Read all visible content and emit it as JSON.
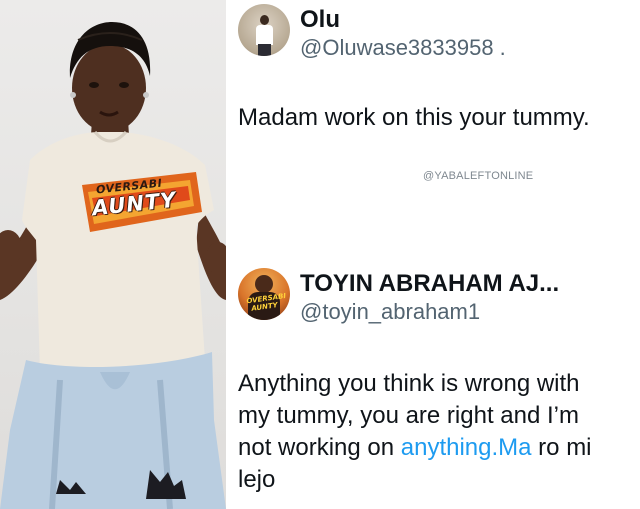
{
  "photo": {
    "shirt_brand_top": "OVERSABI",
    "shirt_brand_main": "AUNTY"
  },
  "tweet1": {
    "display_name": "Olu",
    "handle": "@Oluwase3833958 .",
    "text": "Madam work on this your tummy."
  },
  "watermark": "@YABALEFTONLINE",
  "tweet2": {
    "display_name": "TOYIN ABRAHAM AJ...",
    "handle": "@toyin_abraham1",
    "avatar_text": "OVERSABI AUNTY",
    "text_line1": "Anything you think is wrong with",
    "text_line2": "my tummy, you are right and I’m",
    "text_line3_before": "not working on ",
    "text_line3_link": "anything.Ma",
    "text_line3_after": " ro mi",
    "text_line4": "lejo"
  },
  "colors": {
    "link": "#1d9bf0",
    "text": "#0f1419",
    "handle": "#536471",
    "shirt": "#efe9de",
    "shirt_logo_orange": "#e0651c",
    "jeans": "#b9cde0"
  }
}
